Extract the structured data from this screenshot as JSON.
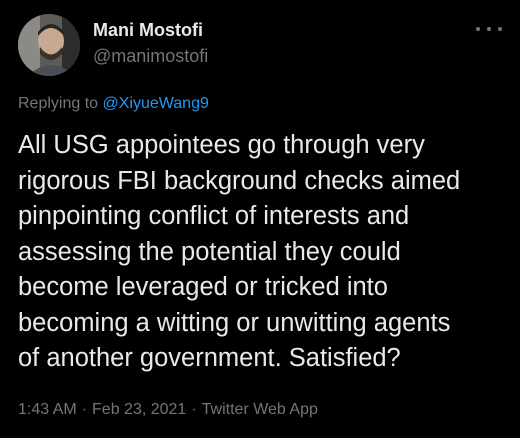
{
  "user": {
    "name": "Mani Mostofi",
    "handle": "@manimostofi",
    "avatar_icon": "profile-photo"
  },
  "reply": {
    "prefix": "Replying to ",
    "mention": "@XiyueWang9"
  },
  "tweet": {
    "lines": [
      "All USG appointees go through very",
      "rigorous FBI background checks aimed",
      "pinpointing conflict of interests and",
      "assessing the potential they could",
      "become leveraged or tricked into",
      "becoming a witting or unwitting agents",
      "of another government. Satisfied?"
    ]
  },
  "meta": {
    "time": "1:43 AM",
    "separator": "·",
    "date": "Feb 23, 2021",
    "app": "Twitter Web App"
  },
  "colors": {
    "background": "#000000",
    "text": "#e7e9ea",
    "secondary": "#71767b",
    "accent": "#1d9bf0"
  }
}
